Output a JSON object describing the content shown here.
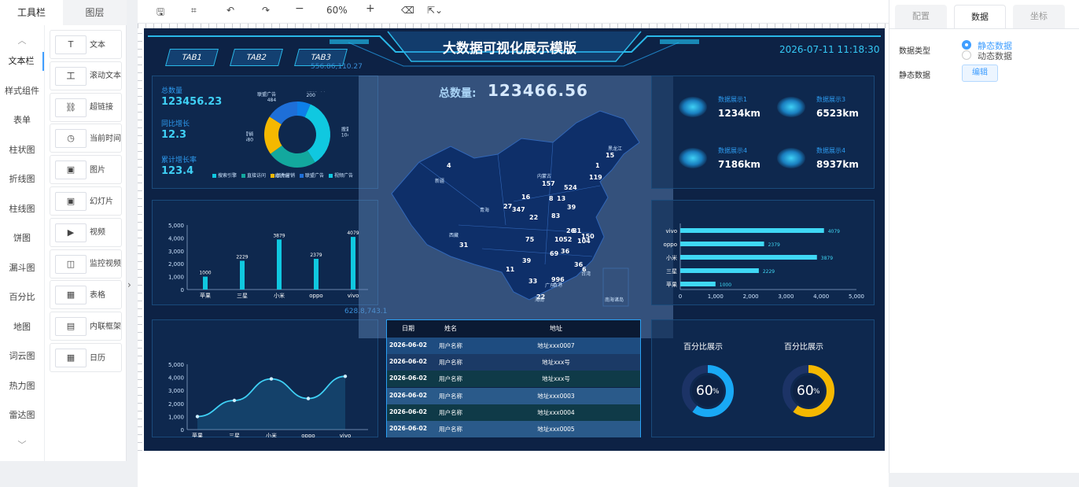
{
  "left": {
    "tabs": [
      "工具栏",
      "图层"
    ],
    "categories": [
      "文本栏",
      "样式组件",
      "表单",
      "柱状图",
      "折线图",
      "柱线图",
      "饼图",
      "漏斗图",
      "百分比",
      "地图",
      "词云图",
      "热力图",
      "雷达图"
    ],
    "components": [
      {
        "icon": "T",
        "label": "文本"
      },
      {
        "icon": "工",
        "label": "滚动文本"
      },
      {
        "icon": "⛓",
        "label": "超链接"
      },
      {
        "icon": "◷",
        "label": "当前时间"
      },
      {
        "icon": "▣",
        "label": "图片"
      },
      {
        "icon": "▣",
        "label": "幻灯片"
      },
      {
        "icon": "▶",
        "label": "视频"
      },
      {
        "icon": "◫",
        "label": "监控视频"
      },
      {
        "icon": "▦",
        "label": "表格"
      },
      {
        "icon": "▤",
        "label": "内联框架"
      },
      {
        "icon": "▦",
        "label": "日历"
      }
    ]
  },
  "toolbar": {
    "zoom": "60%"
  },
  "right": {
    "tabs": [
      "配置",
      "数据",
      "坐标"
    ],
    "data_type_label": "数据类型",
    "options": [
      "静态数据",
      "动态数据"
    ],
    "static_label": "静态数据",
    "edit_button": "编辑"
  },
  "dash": {
    "title": "大数据可视化展示模版",
    "datetime": "2026-07-11 11:18:30",
    "tabs": [
      "TAB1",
      "TAB2",
      "TAB3"
    ],
    "coord_label": "556.86,110.27",
    "coord_label2": "628.8,743.1",
    "stats": [
      {
        "label": "总数量",
        "value": "123456.23"
      },
      {
        "label": "同比增长",
        "value": "12.3"
      },
      {
        "label": "累计增长率",
        "value": "123.4"
      }
    ],
    "donut": {
      "slices": [
        {
          "name": "视频广告",
          "value": 200,
          "color": "#0d7fe8"
        },
        {
          "name": "搜索引擎",
          "value": 1048,
          "color": "#10c8e0"
        },
        {
          "name": "直接访问",
          "value": 735,
          "color": "#13a89e"
        },
        {
          "name": "邮件营销",
          "value": 580,
          "color": "#f5b800"
        },
        {
          "name": "联盟广告",
          "value": 484,
          "color": "#1e6fd8"
        }
      ],
      "legend": [
        "搜索引擎",
        "直接访问",
        "邮件营销",
        "联盟广告",
        "视频广告"
      ]
    },
    "map_total_label": "总数量:",
    "map_total": "123466.56",
    "map_numbers": [
      "4",
      "15",
      "524",
      "157",
      "16",
      "13",
      "27",
      "347",
      "8",
      "39",
      "83",
      "22",
      "26",
      "81",
      "150",
      "75",
      "1052",
      "104",
      "69",
      "36",
      "31",
      "39",
      "11",
      "33",
      "996",
      "36",
      "6",
      "22",
      "119",
      "1"
    ],
    "map_labels": [
      "新疆",
      "西藏",
      "青海",
      "内蒙古",
      "黑龙江",
      "广东",
      "海南",
      "南海诸岛",
      "台湾",
      "香港"
    ],
    "kpis": [
      {
        "label": "数据展示1",
        "value": "1234km"
      },
      {
        "label": "数据展示3",
        "value": "6523km"
      },
      {
        "label": "数据展示4",
        "value": "7186km"
      },
      {
        "label": "数据展示4",
        "value": "8937km"
      }
    ],
    "table": {
      "headers": [
        "日期",
        "姓名",
        "地址"
      ],
      "rows": [
        [
          "2026-06-02",
          "用户名称",
          "地址xxx0007"
        ],
        [
          "2026-06-02",
          "用户名称",
          "地址xxx号"
        ],
        [
          "2026-06-02",
          "用户名称",
          "地址xxx号"
        ],
        [
          "2026-06-02",
          "用户名称",
          "地址xxx0003"
        ],
        [
          "2026-06-02",
          "用户名称",
          "地址xxx0004"
        ],
        [
          "2026-06-02",
          "用户名称",
          "地址xxx0005"
        ]
      ]
    },
    "pct": [
      {
        "title": "百分比展示",
        "value": "60",
        "sign": "%",
        "ratio": 0.6,
        "color": "#19a9f5"
      },
      {
        "title": "百分比展示",
        "value": "60",
        "sign": "%",
        "ratio": 0.6,
        "color": "#f5b800"
      }
    ]
  },
  "chart_data": [
    {
      "type": "bar",
      "categories": [
        "苹果",
        "三星",
        "小米",
        "oppo",
        "vivo"
      ],
      "values": [
        1000,
        2229,
        3879,
        2379,
        4079
      ],
      "ylim": [
        0,
        5000
      ],
      "yticks": [
        "0",
        "1,000",
        "2,000",
        "3,000",
        "4,000",
        "5,000"
      ]
    },
    {
      "type": "line",
      "categories": [
        "苹果",
        "三星",
        "小米",
        "oppo",
        "vivo"
      ],
      "values": [
        1000,
        2229,
        3879,
        2379,
        4079
      ],
      "ylim": [
        0,
        5000
      ],
      "yticks": [
        "0",
        "1,000",
        "2,000",
        "3,000",
        "4,000",
        "5,000"
      ]
    },
    {
      "type": "bar",
      "orientation": "horizontal",
      "categories": [
        "vivo",
        "oppo",
        "小米",
        "三星",
        "苹果"
      ],
      "values": [
        4079,
        2379,
        3879,
        2229,
        1000
      ],
      "xlim": [
        0,
        5000
      ],
      "xticks": [
        "0",
        "1,000",
        "2,000",
        "3,000",
        "4,000",
        "5,000"
      ]
    }
  ]
}
